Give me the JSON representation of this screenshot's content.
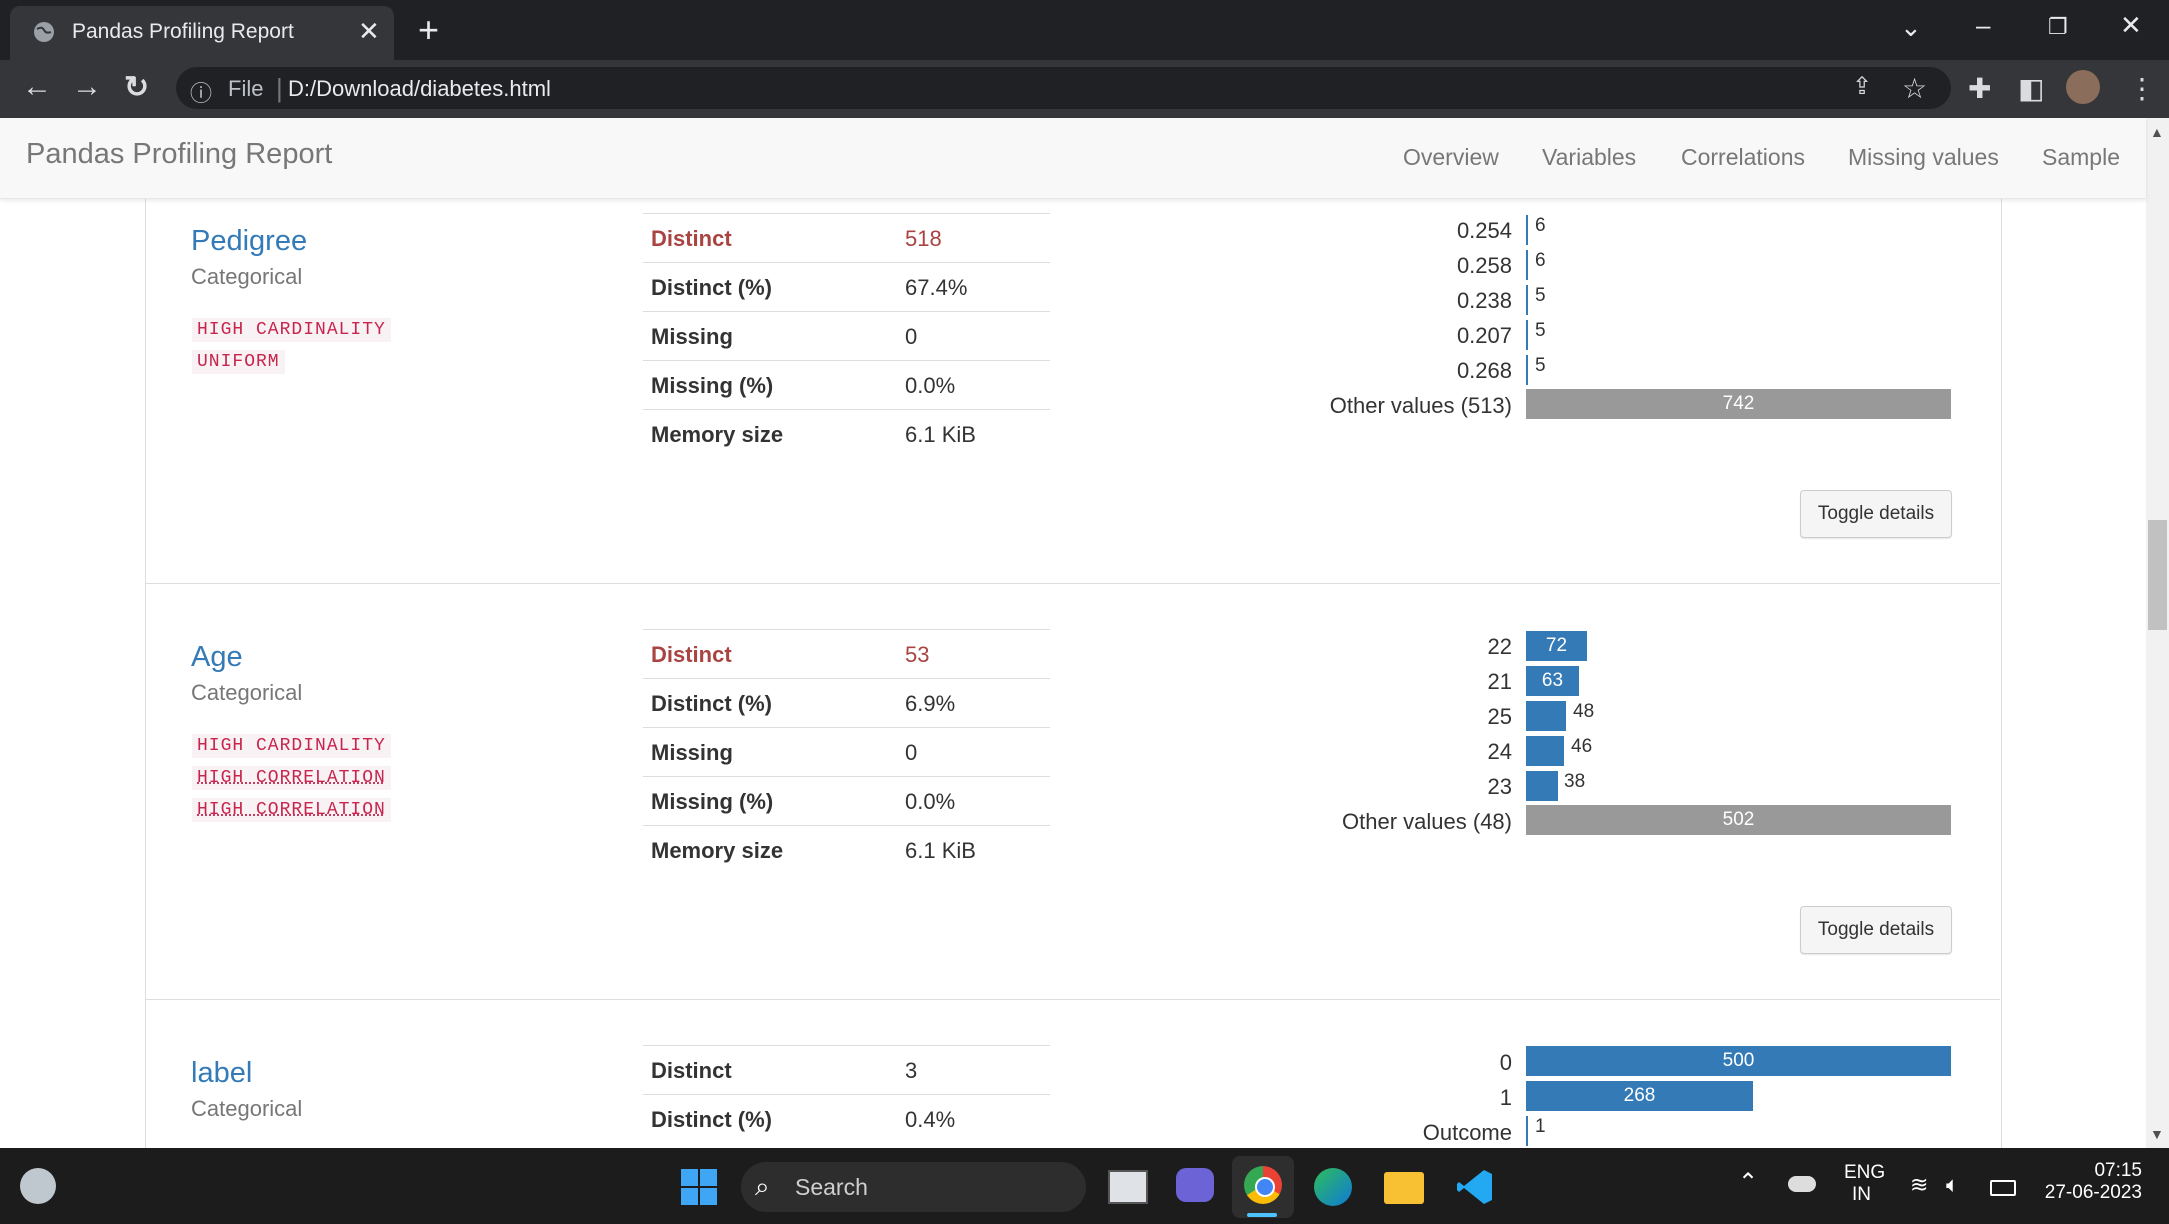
{
  "browser": {
    "tab_title": "Pandas Profiling Report",
    "tab_close": "✕",
    "new_tab": "+",
    "address_prefix": "File",
    "url": "D:/Download/diabetes.html"
  },
  "navbar": {
    "brand": "Pandas Profiling Report",
    "links": [
      "Overview",
      "Variables",
      "Correlations",
      "Missing values",
      "Sample"
    ]
  },
  "variables": [
    {
      "name": "Pedigree",
      "type": "Categorical",
      "badges": [
        "HIGH CARDINALITY",
        "UNIFORM"
      ],
      "stats": [
        {
          "k": "Distinct",
          "v": "518"
        },
        {
          "k": "Distinct (%)",
          "v": "67.4%"
        },
        {
          "k": "Missing",
          "v": "0"
        },
        {
          "k": "Missing (%)",
          "v": "0.0%"
        },
        {
          "k": "Memory size",
          "v": "6.1 KiB"
        }
      ],
      "freq": [
        {
          "label": "0.254",
          "count": "6"
        },
        {
          "label": "0.258",
          "count": "6"
        },
        {
          "label": "0.238",
          "count": "5"
        },
        {
          "label": "0.207",
          "count": "5"
        },
        {
          "label": "0.268",
          "count": "5"
        },
        {
          "label": "Other values (513)",
          "count": "742"
        }
      ],
      "toggle": "Toggle details"
    },
    {
      "name": "Age",
      "type": "Categorical",
      "badges": [
        "HIGH CARDINALITY",
        "HIGH CORRELATION",
        "HIGH CORRELATION"
      ],
      "stats": [
        {
          "k": "Distinct",
          "v": "53"
        },
        {
          "k": "Distinct (%)",
          "v": "6.9%"
        },
        {
          "k": "Missing",
          "v": "0"
        },
        {
          "k": "Missing (%)",
          "v": "0.0%"
        },
        {
          "k": "Memory size",
          "v": "6.1 KiB"
        }
      ],
      "freq": [
        {
          "label": "22",
          "count": "72"
        },
        {
          "label": "21",
          "count": "63"
        },
        {
          "label": "25",
          "count": "48"
        },
        {
          "label": "24",
          "count": "46"
        },
        {
          "label": "23",
          "count": "38"
        },
        {
          "label": "Other values (48)",
          "count": "502"
        }
      ],
      "toggle": "Toggle details"
    },
    {
      "name": "label",
      "type": "Categorical",
      "stats": [
        {
          "k": "Distinct",
          "v": "3"
        },
        {
          "k": "Distinct (%)",
          "v": "0.4%"
        }
      ],
      "freq": [
        {
          "label": "0",
          "count": "500"
        },
        {
          "label": "1",
          "count": "268"
        },
        {
          "label": "Outcome",
          "count": "1"
        }
      ]
    }
  ],
  "taskbar": {
    "search": "Search",
    "lang1": "ENG",
    "lang2": "IN",
    "time": "07:15",
    "date": "27-06-2023"
  },
  "colors": {
    "accent": "#337ab7",
    "warn": "#a94442",
    "badge": "#c7254e",
    "other_bar": "#999999"
  }
}
